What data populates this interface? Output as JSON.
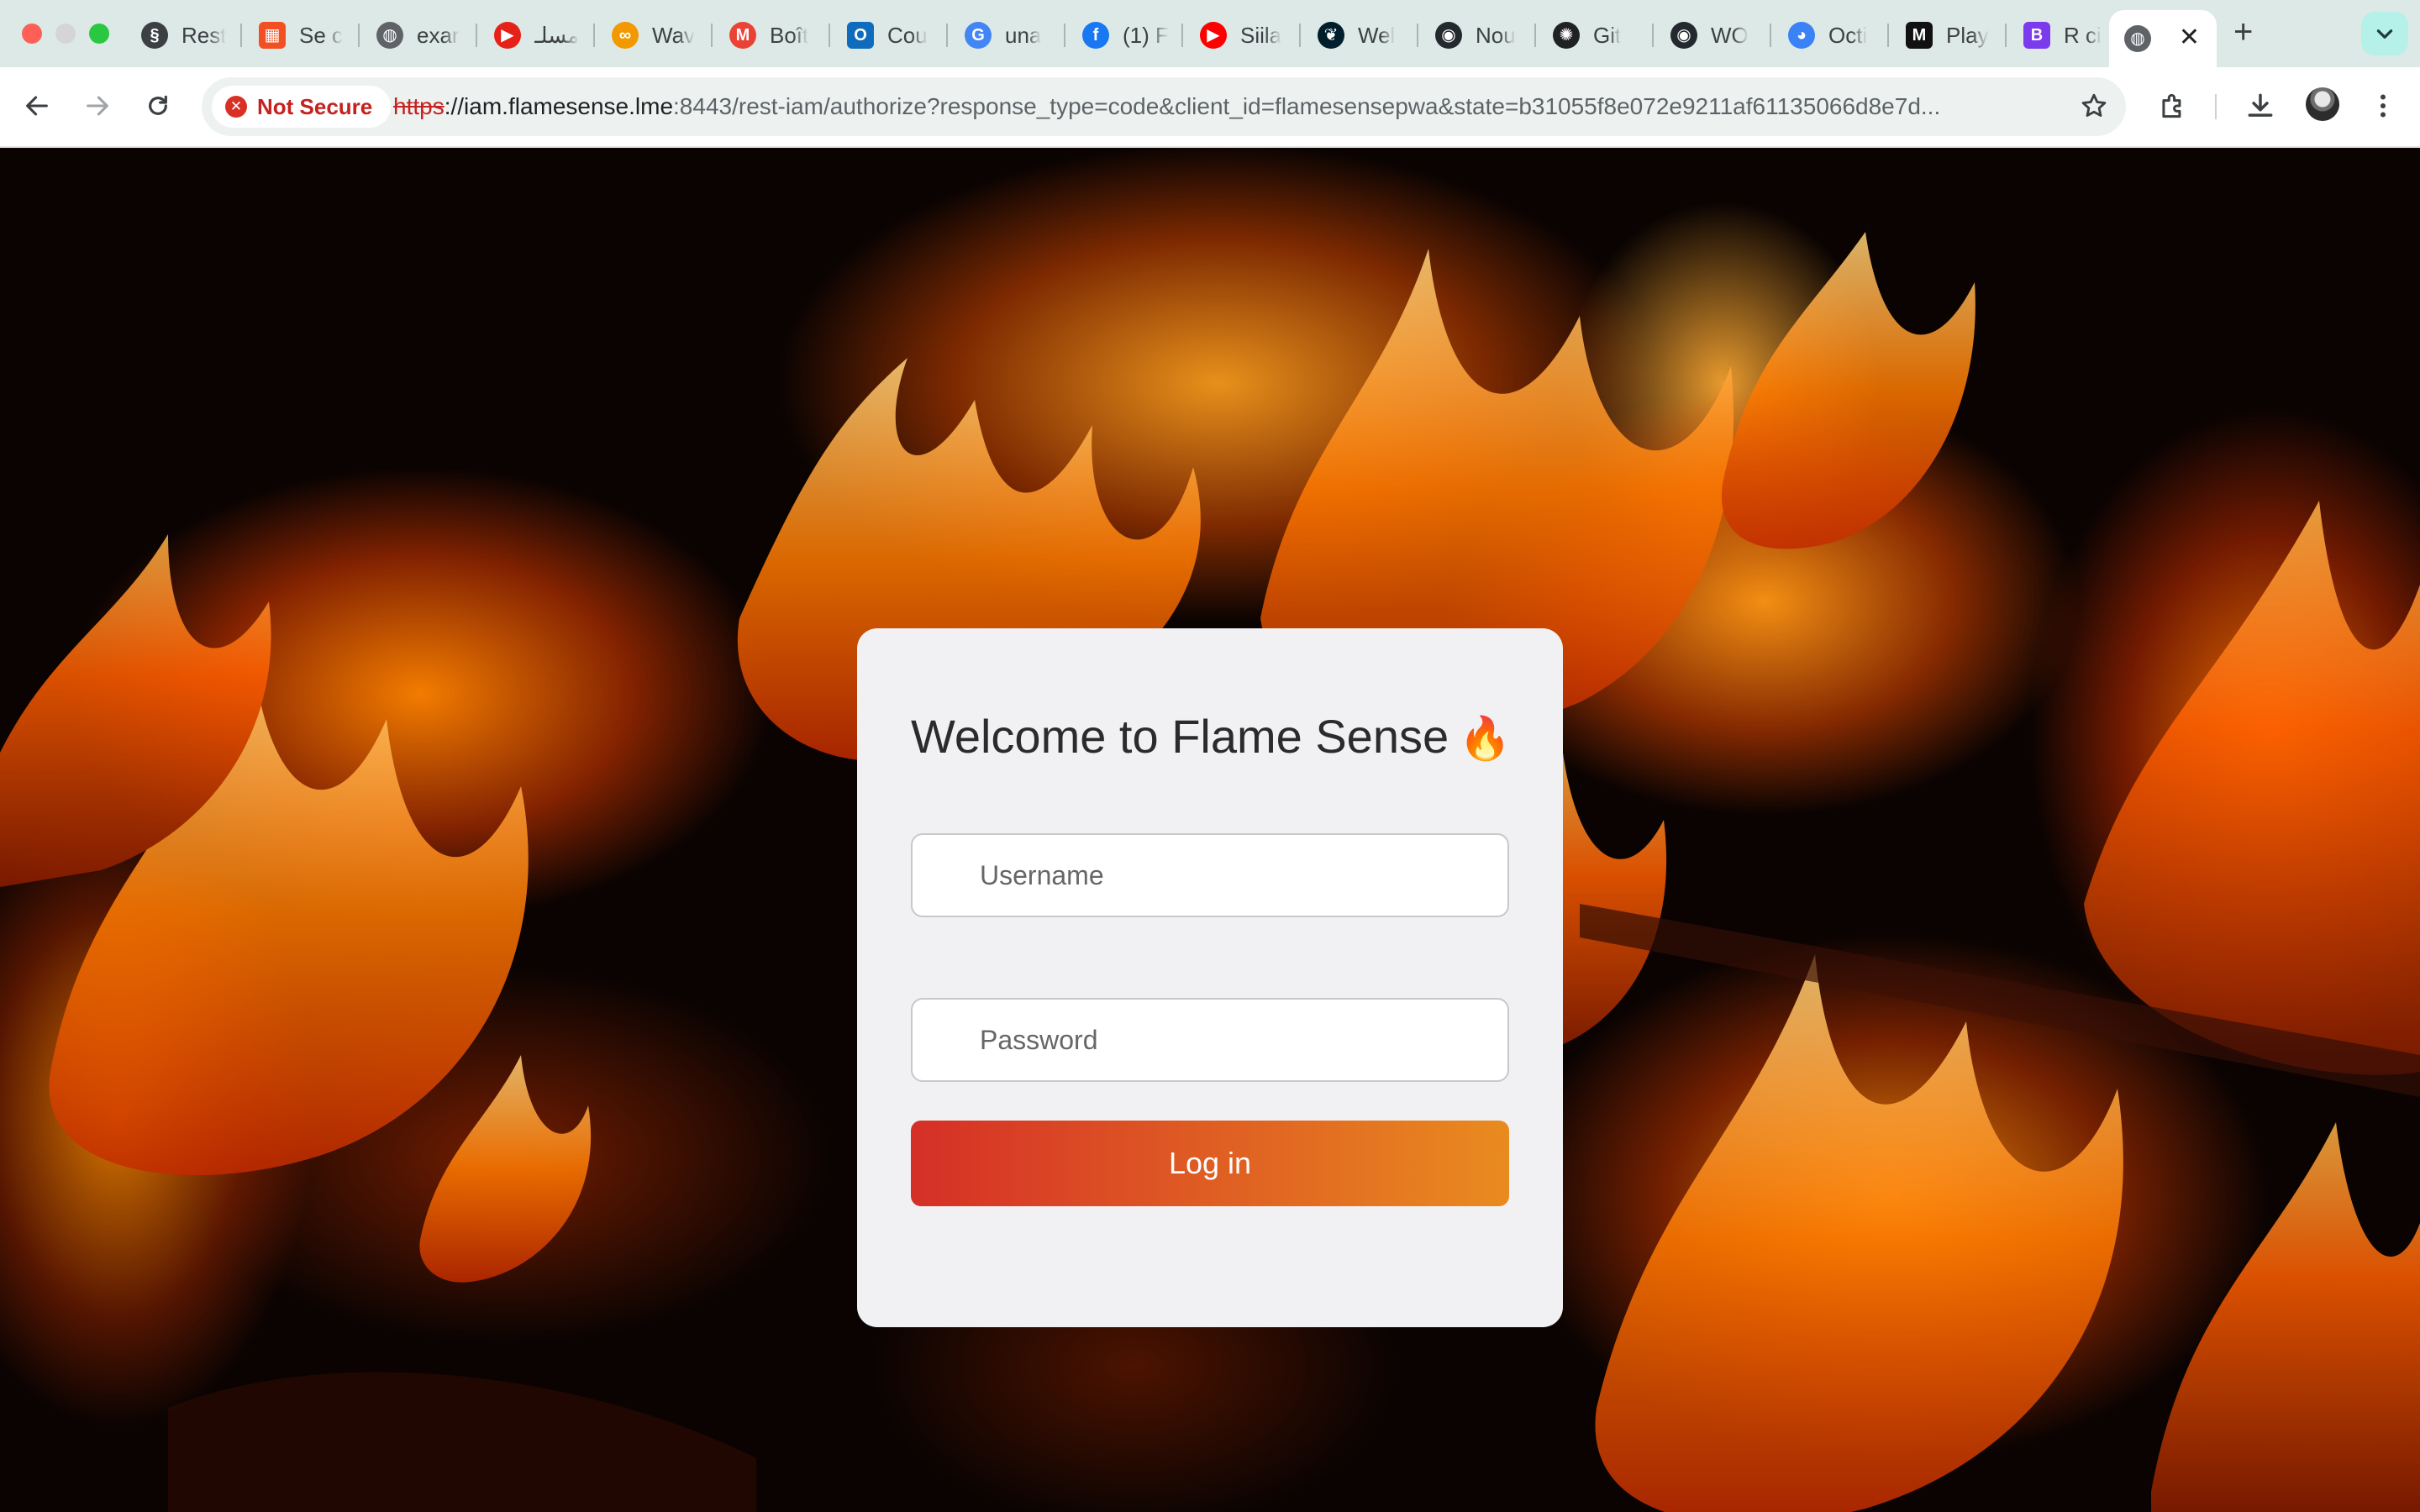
{
  "browser": {
    "tabs": [
      {
        "label": "Rest",
        "icon": "leaf-icon",
        "color": "#3c4043"
      },
      {
        "label": "Se c",
        "icon": "microsoft-logo-icon",
        "color": "#f25022"
      },
      {
        "label": "exar",
        "icon": "globe-icon",
        "color": "#5f6368"
      },
      {
        "label": "مسلـ",
        "icon": "youtube-icon",
        "color": "#e62117"
      },
      {
        "label": "Wav",
        "icon": "infinity-icon",
        "color": "#f29900"
      },
      {
        "label": "Boît",
        "icon": "gmail-icon",
        "color": "#ea4335"
      },
      {
        "label": "Cou",
        "icon": "outlook-icon",
        "color": "#0f6cbd"
      },
      {
        "label": "una",
        "icon": "google-icon",
        "color": "#4285f4"
      },
      {
        "label": "(1) F",
        "icon": "facebook-icon",
        "color": "#1877f2"
      },
      {
        "label": "Siila",
        "icon": "youtube-icon",
        "color": "#ff0000"
      },
      {
        "label": "Wel",
        "icon": "mongodb-leaf-icon",
        "color": "#001e2b"
      },
      {
        "label": "Nou",
        "icon": "github-icon",
        "color": "#24292f"
      },
      {
        "label": "Git",
        "icon": "openai-icon",
        "color": "#202123"
      },
      {
        "label": "WO",
        "icon": "github-icon",
        "color": "#24292f"
      },
      {
        "label": "Octi",
        "icon": "octicon-icon",
        "color": "#3b82f6"
      },
      {
        "label": "Play",
        "icon": "m-logo-icon",
        "color": "#111111"
      },
      {
        "label": "R ci",
        "icon": "b-logo-icon",
        "color": "#7c3aed"
      },
      {
        "label": "",
        "icon": "globe-icon",
        "color": "#5f6368",
        "active": true
      }
    ],
    "security_label": "Not Secure",
    "url_scheme": "https",
    "url_host": "://iam.flamesense.lme",
    "url_rest": ":8443/rest-iam/authorize?response_type=code&client_id=flamesensepwa&state=b31055f8e072e9211af61135066d8e7d...",
    "colors": {
      "tabstrip": "#dde9e6",
      "insecure": "#c5221f"
    }
  },
  "login": {
    "title": "Welcome to Flame Sense",
    "title_emoji": "🔥",
    "username_placeholder": "Username",
    "password_placeholder": "Password",
    "login_label": "Log in",
    "button_gradient": [
      "#d52f27",
      "#e98b1f"
    ]
  }
}
